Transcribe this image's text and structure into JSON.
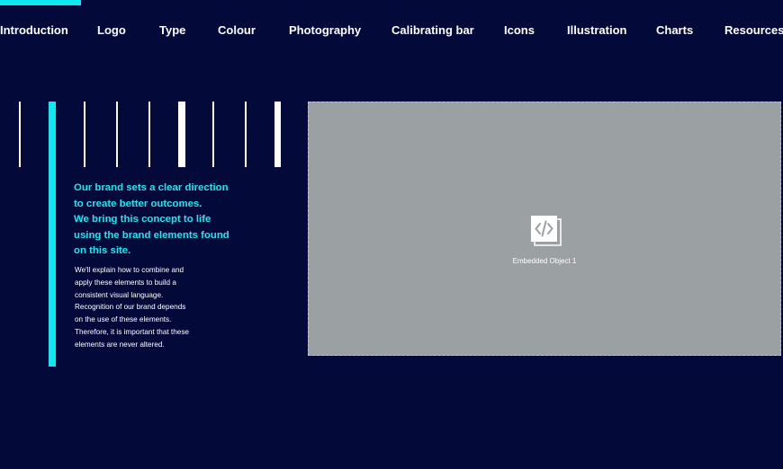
{
  "nav": {
    "items": [
      {
        "label": "Introduction"
      },
      {
        "label": "Logo"
      },
      {
        "label": "Type"
      },
      {
        "label": "Colour"
      },
      {
        "label": "Photography"
      },
      {
        "label": "Calibrating bar"
      },
      {
        "label": "Icons"
      },
      {
        "label": "Illustration"
      },
      {
        "label": "Charts"
      },
      {
        "label": "Resources"
      }
    ]
  },
  "intro": {
    "headline_lines": [
      "Our brand sets a clear direction",
      "to create better outcomes.",
      "We bring this concept to life",
      "using the brand elements found",
      "on this site."
    ],
    "body_lines": [
      "We'll explain how to combine and",
      "apply these elements to build a",
      "consistent visual language.",
      "Recognition of our brand depends",
      "on the use of these elements.",
      "Therefore, it is important that these",
      "elements are never altered."
    ]
  },
  "embed": {
    "label": "Embedded Object 1",
    "icon": "code-embed-icon"
  },
  "colors": {
    "background": "#030a3a",
    "accent": "#10e8f0",
    "headline": "#20e6f0",
    "embed_placeholder": "#9ba0a3"
  }
}
